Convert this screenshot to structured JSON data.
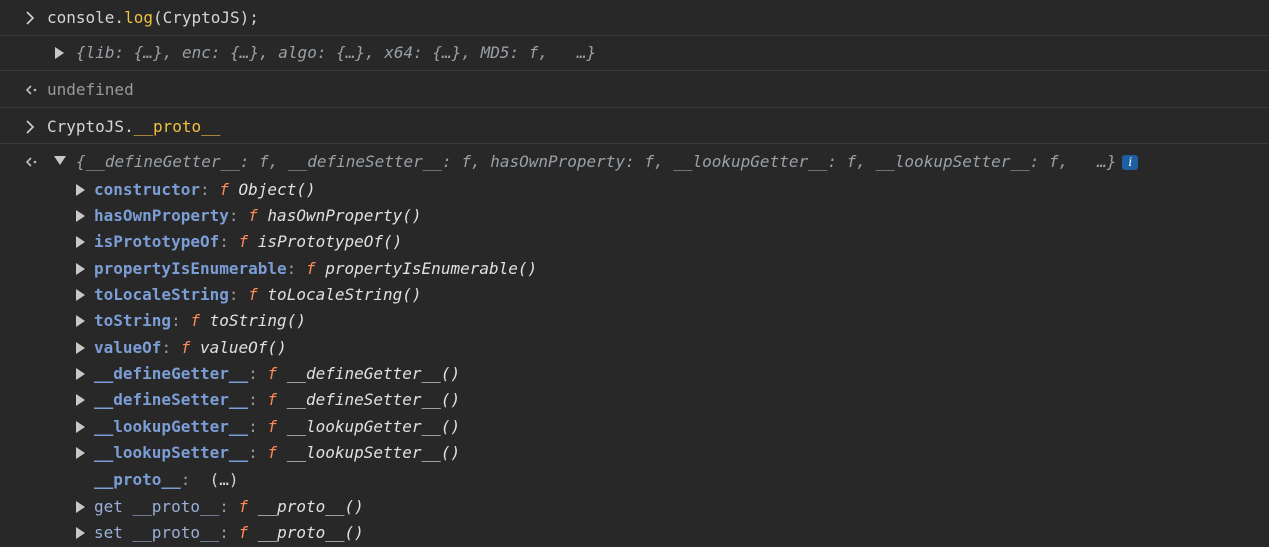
{
  "console": {
    "cmd1": {
      "text_prefix": "console.",
      "fn": "log",
      "text_suffix": "(CryptoJS);"
    },
    "result1": "{lib: {…}, enc: {…}, algo: {…}, x64: {…}, MD5: f,   …}",
    "return1": "undefined",
    "cmd2": {
      "text_prefix": "CryptoJS.",
      "highlight": "__proto__"
    },
    "result2_summary": "{__defineGetter__: f, __defineSetter__: f, hasOwnProperty: f, __lookupGetter__: f, __lookupSetter__: f,   …}",
    "info_badge": "i",
    "fn_glyph": "f",
    "separator": ":",
    "properties": [
      {
        "name": "constructor",
        "fn": "Object()"
      },
      {
        "name": "hasOwnProperty",
        "fn": "hasOwnProperty()"
      },
      {
        "name": "isPrototypeOf",
        "fn": "isPrototypeOf()"
      },
      {
        "name": "propertyIsEnumerable",
        "fn": "propertyIsEnumerable()"
      },
      {
        "name": "toLocaleString",
        "fn": "toLocaleString()"
      },
      {
        "name": "toString",
        "fn": "toString()"
      },
      {
        "name": "valueOf",
        "fn": "valueOf()"
      },
      {
        "name": "__defineGetter__",
        "fn": "__defineGetter__()"
      },
      {
        "name": "__defineSetter__",
        "fn": "__defineSetter__()"
      },
      {
        "name": "__lookupGetter__",
        "fn": "__lookupGetter__()"
      },
      {
        "name": "__lookupSetter__",
        "fn": "__lookupSetter__()"
      }
    ],
    "proto_row": {
      "name": "__proto__",
      "value": "(…)"
    },
    "accessors": [
      {
        "name": "get __proto__",
        "fn": "__proto__()"
      },
      {
        "name": "set __proto__",
        "fn": "__proto__()"
      }
    ]
  }
}
